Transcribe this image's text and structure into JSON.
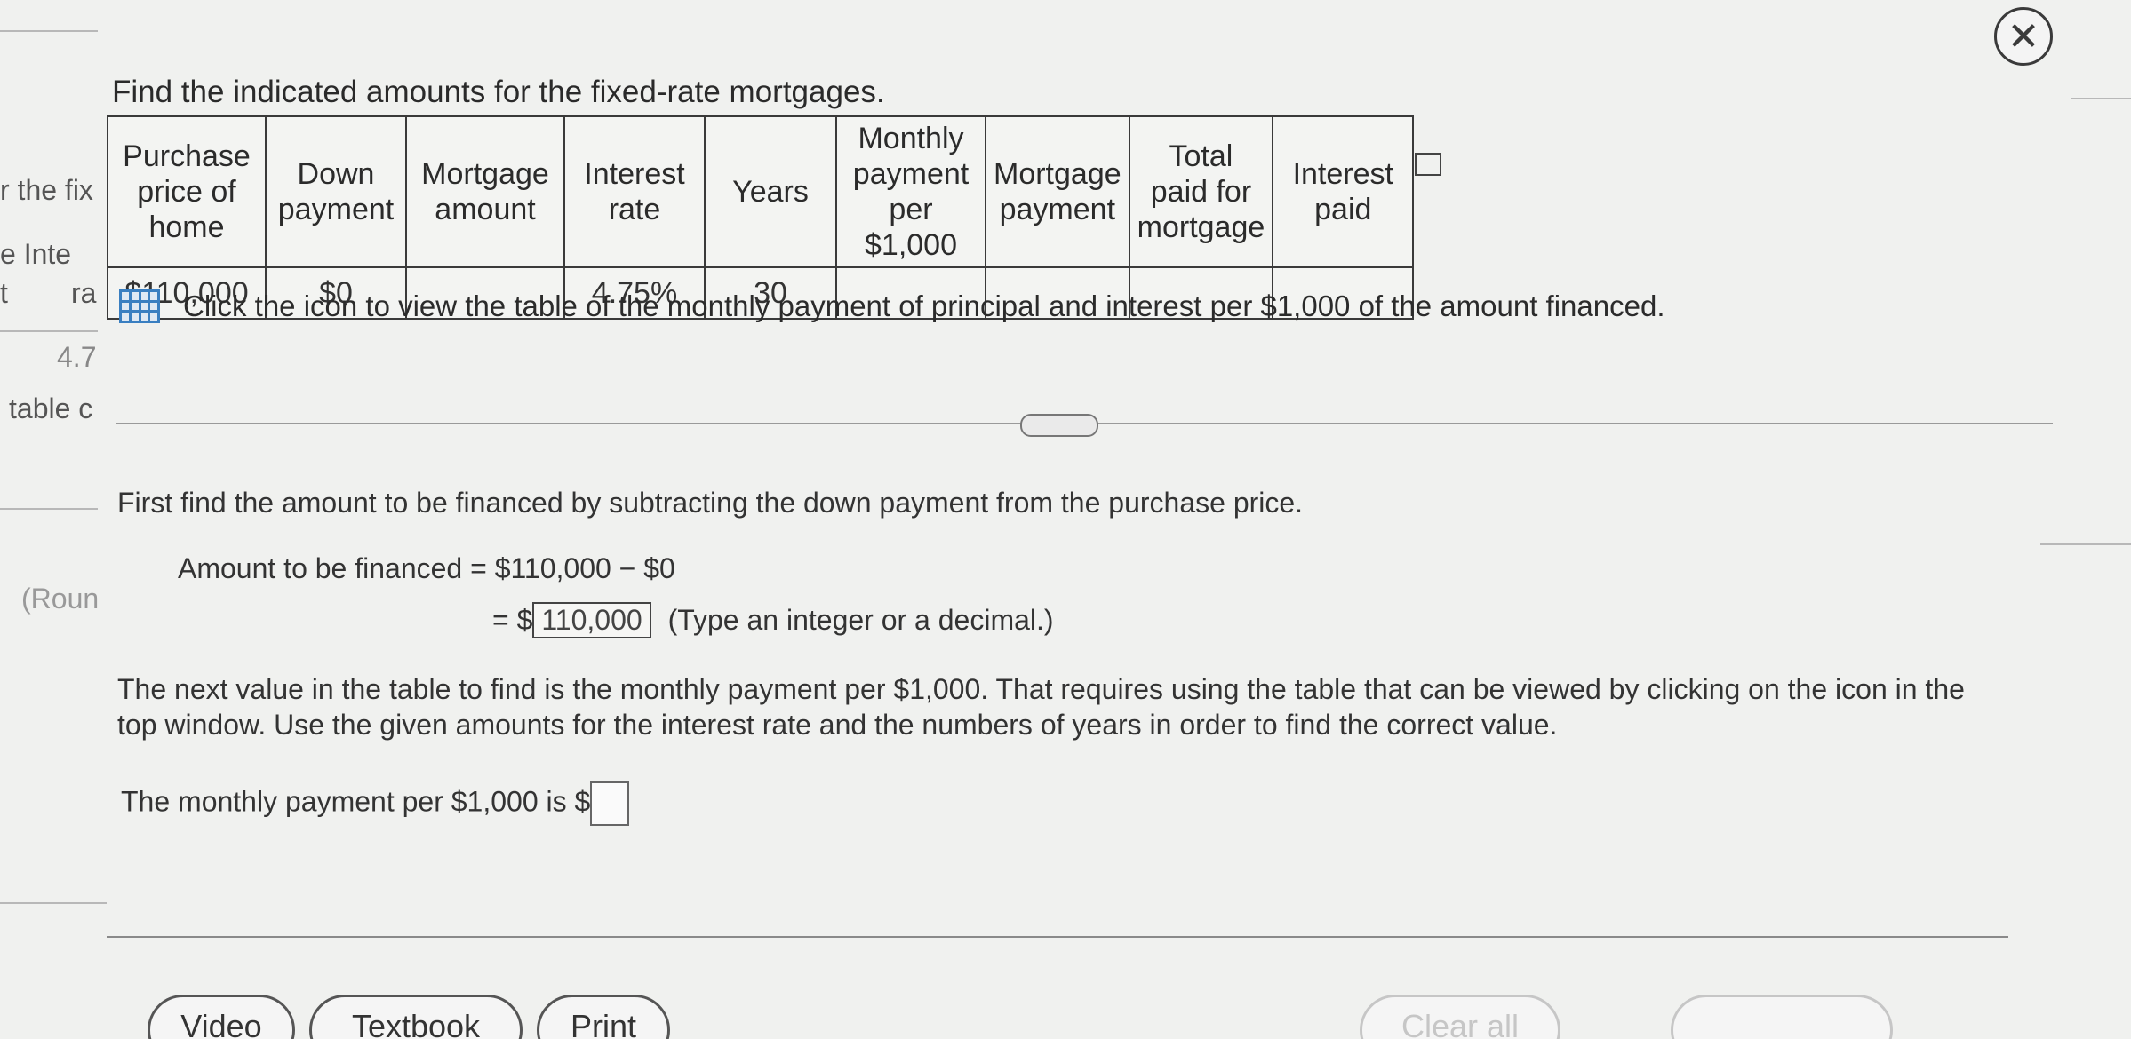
{
  "background_fragments": {
    "frag1": "r the fix",
    "frag2": "e Inte",
    "frag3": "t",
    "frag4": "ra",
    "frag5": "4.7",
    "frag6": "table c",
    "frag7": "(Roun"
  },
  "prompt": "Find the indicated amounts for the fixed-rate mortgages.",
  "table": {
    "headers": [
      "Purchase price of home",
      "Down payment",
      "Mortgage amount",
      "Interest rate",
      "Years",
      "Monthly payment per $1,000",
      "Mortgage payment",
      "Total paid for mortgage",
      "Interest paid"
    ],
    "row": [
      "$110,000",
      "$0",
      "",
      "4.75%",
      "30",
      "",
      "",
      "",
      ""
    ]
  },
  "info_text": "Click the icon to view the table of the monthly payment of principal and interest per $1,000 of the amount financed.",
  "steps": {
    "s1": "First find the amount to be financed by subtracting the down payment from the purchase price.",
    "amount_label": "Amount to be financed = $110,000 − $0",
    "eq_prefix": "= $",
    "amount_answer": "110,000",
    "type_hint": "(Type an integer or a decimal.)",
    "s2": "The next value in the table to find is the monthly payment per $1,000. That requires using the table that can be viewed by clicking on the icon in the top window. Use the given amounts for the interest rate and the numbers of years in order to find the correct value.",
    "monthly_prompt": "The monthly payment per $1,000 is $"
  },
  "buttons": {
    "video": "Video",
    "textbook": "Textbook",
    "print": "Print",
    "clear_all": "Clear all"
  }
}
